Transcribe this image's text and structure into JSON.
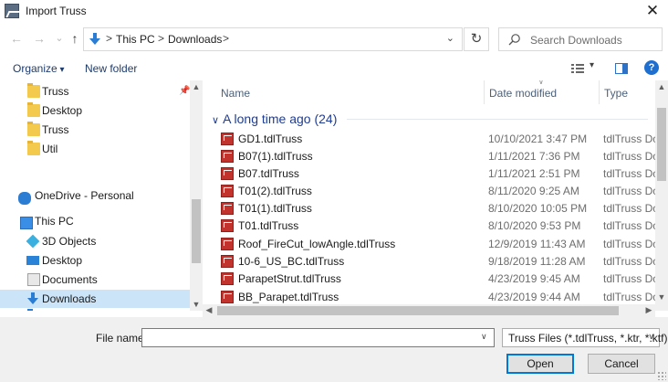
{
  "window": {
    "title": "Import Truss",
    "close_glyph": "✕"
  },
  "nav": {
    "back_glyph": "←",
    "forward_glyph": "→",
    "recent_glyph": "⌄",
    "up_glyph": "↑",
    "breadcrumbs": [
      "This PC",
      "Downloads"
    ],
    "separator": ">",
    "address_dropdown_glyph": "⌄",
    "refresh_glyph": "↻",
    "search_placeholder": "Search Downloads"
  },
  "toolbar": {
    "organize_label": "Organize",
    "new_folder_label": "New folder",
    "help_glyph": "?",
    "view_dropdown_glyph": "▾"
  },
  "sidebar": {
    "pin_glyph": "📌",
    "items": [
      {
        "label": "Truss",
        "icon": "folder-icon"
      },
      {
        "label": "Desktop",
        "icon": "folder-icon"
      },
      {
        "label": "Truss",
        "icon": "folder-icon"
      },
      {
        "label": "Util",
        "icon": "folder-icon"
      },
      {
        "label": "OneDrive - Personal",
        "icon": "cloud-icon"
      },
      {
        "label": "This PC",
        "icon": "pc-icon"
      },
      {
        "label": "3D Objects",
        "icon": "cube-icon"
      },
      {
        "label": "Desktop",
        "icon": "desktop-icon"
      },
      {
        "label": "Documents",
        "icon": "documents-icon"
      },
      {
        "label": "Downloads",
        "icon": "downloads-icon",
        "selected": true
      }
    ]
  },
  "file_list": {
    "columns": {
      "name": "Name",
      "date_modified": "Date modified",
      "type": "Type"
    },
    "group_label": "A long time ago (24)",
    "group_chevron": "∨",
    "files": [
      {
        "name": "GD1.tdlTruss",
        "date": "10/10/2021 3:47 PM",
        "type": "tdlTruss Doc"
      },
      {
        "name": "B07(1).tdlTruss",
        "date": "1/11/2021 7:36 PM",
        "type": "tdlTruss Doc"
      },
      {
        "name": "B07.tdlTruss",
        "date": "1/11/2021 2:51 PM",
        "type": "tdlTruss Doc"
      },
      {
        "name": "T01(2).tdlTruss",
        "date": "8/11/2020 9:25 AM",
        "type": "tdlTruss Doc"
      },
      {
        "name": "T01(1).tdlTruss",
        "date": "8/10/2020 10:05 PM",
        "type": "tdlTruss Doc"
      },
      {
        "name": "T01.tdlTruss",
        "date": "8/10/2020 9:53 PM",
        "type": "tdlTruss Doc"
      },
      {
        "name": "Roof_FireCut_lowAngle.tdlTruss",
        "date": "12/9/2019 11:43 AM",
        "type": "tdlTruss Doc"
      },
      {
        "name": "10-6_US_BC.tdlTruss",
        "date": "9/18/2019 11:28 AM",
        "type": "tdlTruss Doc"
      },
      {
        "name": "ParapetStrut.tdlTruss",
        "date": "4/23/2019 9:45 AM",
        "type": "tdlTruss Doc"
      },
      {
        "name": "BB_Parapet.tdlTruss",
        "date": "4/23/2019 9:44 AM",
        "type": "tdlTruss Doc"
      }
    ]
  },
  "footer": {
    "file_name_label": "File name:",
    "file_name_value": "",
    "file_type_selected": "Truss Files (*.tdlTruss, *.ktr, *.ktf)",
    "dropdown_glyph": "∨",
    "open_label": "Open",
    "cancel_label": "Cancel"
  }
}
